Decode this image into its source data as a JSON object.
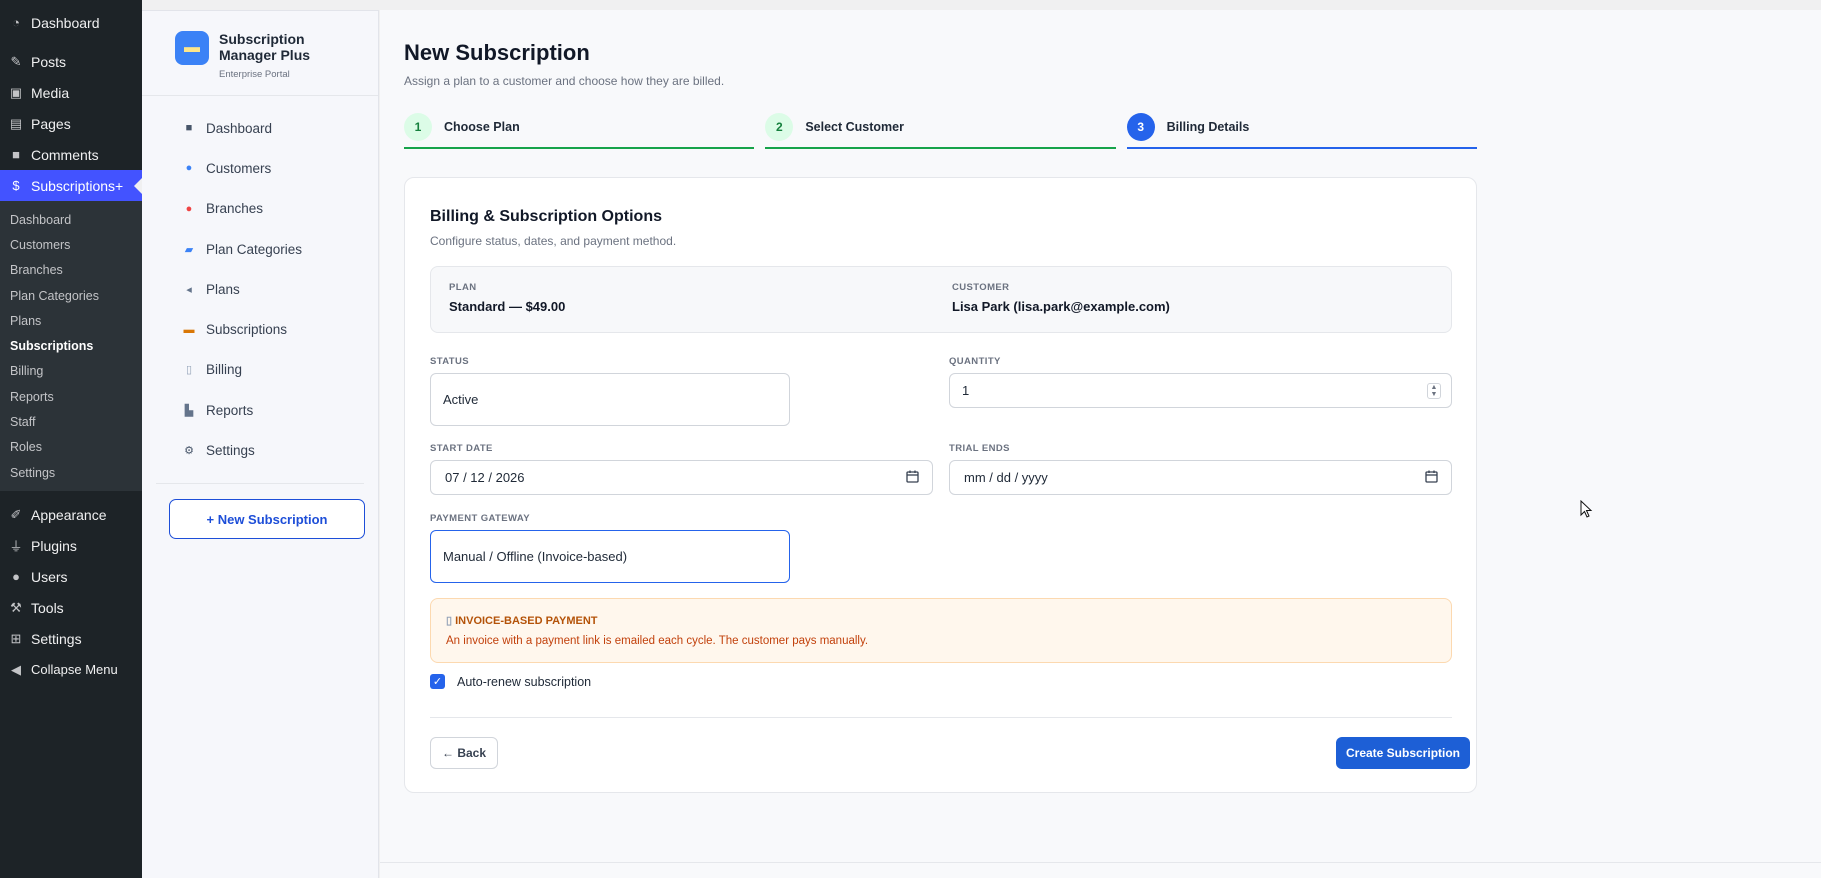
{
  "wp_menu": {
    "top_items_before": [
      {
        "label": "Dashboard",
        "icon": "dashboard-icon"
      },
      {
        "label": "Posts",
        "icon": "pin-icon"
      },
      {
        "label": "Media",
        "icon": "media-icon"
      },
      {
        "label": "Pages",
        "icon": "pages-icon"
      },
      {
        "label": "Comments",
        "icon": "comment-icon"
      }
    ],
    "active_item": {
      "label": "Subscriptions+",
      "icon": "dollar-icon"
    },
    "sub_items": [
      "Dashboard",
      "Customers",
      "Branches",
      "Plan Categories",
      "Plans",
      "Subscriptions",
      "Billing",
      "Reports",
      "Staff",
      "Roles",
      "Settings"
    ],
    "current_sub": "Subscriptions",
    "top_items_after": [
      {
        "label": "Appearance",
        "icon": "brush-icon"
      },
      {
        "label": "Plugins",
        "icon": "plugin-icon"
      },
      {
        "label": "Users",
        "icon": "user-icon"
      },
      {
        "label": "Tools",
        "icon": "wrench-icon"
      },
      {
        "label": "Settings",
        "icon": "settings-icon"
      },
      {
        "label": "Collapse Menu",
        "icon": "collapse-icon"
      }
    ]
  },
  "plugin": {
    "title_line1": "Subscription",
    "title_line2": "Manager Plus",
    "subtitle": "Enterprise Portal",
    "nav": [
      {
        "label": "Dashboard",
        "icon": "dashboard-icon"
      },
      {
        "label": "Customers",
        "icon": "customers-icon"
      },
      {
        "label": "Branches",
        "icon": "pin-icon"
      },
      {
        "label": "Plan Categories",
        "icon": "folder-icon"
      },
      {
        "label": "Plans",
        "icon": "tag-icon"
      },
      {
        "label": "Subscriptions",
        "icon": "card-icon"
      },
      {
        "label": "Billing",
        "icon": "receipt-icon"
      },
      {
        "label": "Reports",
        "icon": "chart-icon"
      },
      {
        "label": "Settings",
        "icon": "gear-icon"
      }
    ],
    "new_button": "+ New Subscription"
  },
  "page": {
    "title": "New Subscription",
    "description": "Assign a plan to a customer and choose how they are billed.",
    "steps": [
      {
        "num": "1",
        "label": "Choose Plan"
      },
      {
        "num": "2",
        "label": "Select Customer"
      },
      {
        "num": "3",
        "label": "Billing Details"
      }
    ]
  },
  "card": {
    "title": "Billing & Subscription Options",
    "description": "Configure status, dates, and payment method.",
    "plan_label": "PLAN",
    "plan_value": "Standard — $49.00",
    "customer_label": "CUSTOMER",
    "customer_value": "Lisa Park (lisa.park@example.com)",
    "status_label": "STATUS",
    "status_value": "Active",
    "quantity_label": "QUANTITY",
    "quantity_value": "1",
    "start_label": "START DATE",
    "start_value": "07 / 12 / 2026",
    "trial_label": "TRIAL ENDS",
    "trial_placeholder": "mm / dd / yyyy",
    "gateway_label": "PAYMENT GATEWAY",
    "gateway_value": "Manual / Offline (Invoice-based)",
    "notice_title": "INVOICE-BASED PAYMENT",
    "notice_text": "An invoice with a payment link is emailed each cycle. The customer pays manually.",
    "auto_renew_label": "Auto-renew subscription",
    "auto_renew_checked": true,
    "back_button": "← Back",
    "create_button": "Create Subscription"
  },
  "colors": {
    "accent": "#2563eb",
    "wp_active": "#4353ff",
    "step_done": "#16a34a",
    "notice_bg": "#fff7ed"
  }
}
